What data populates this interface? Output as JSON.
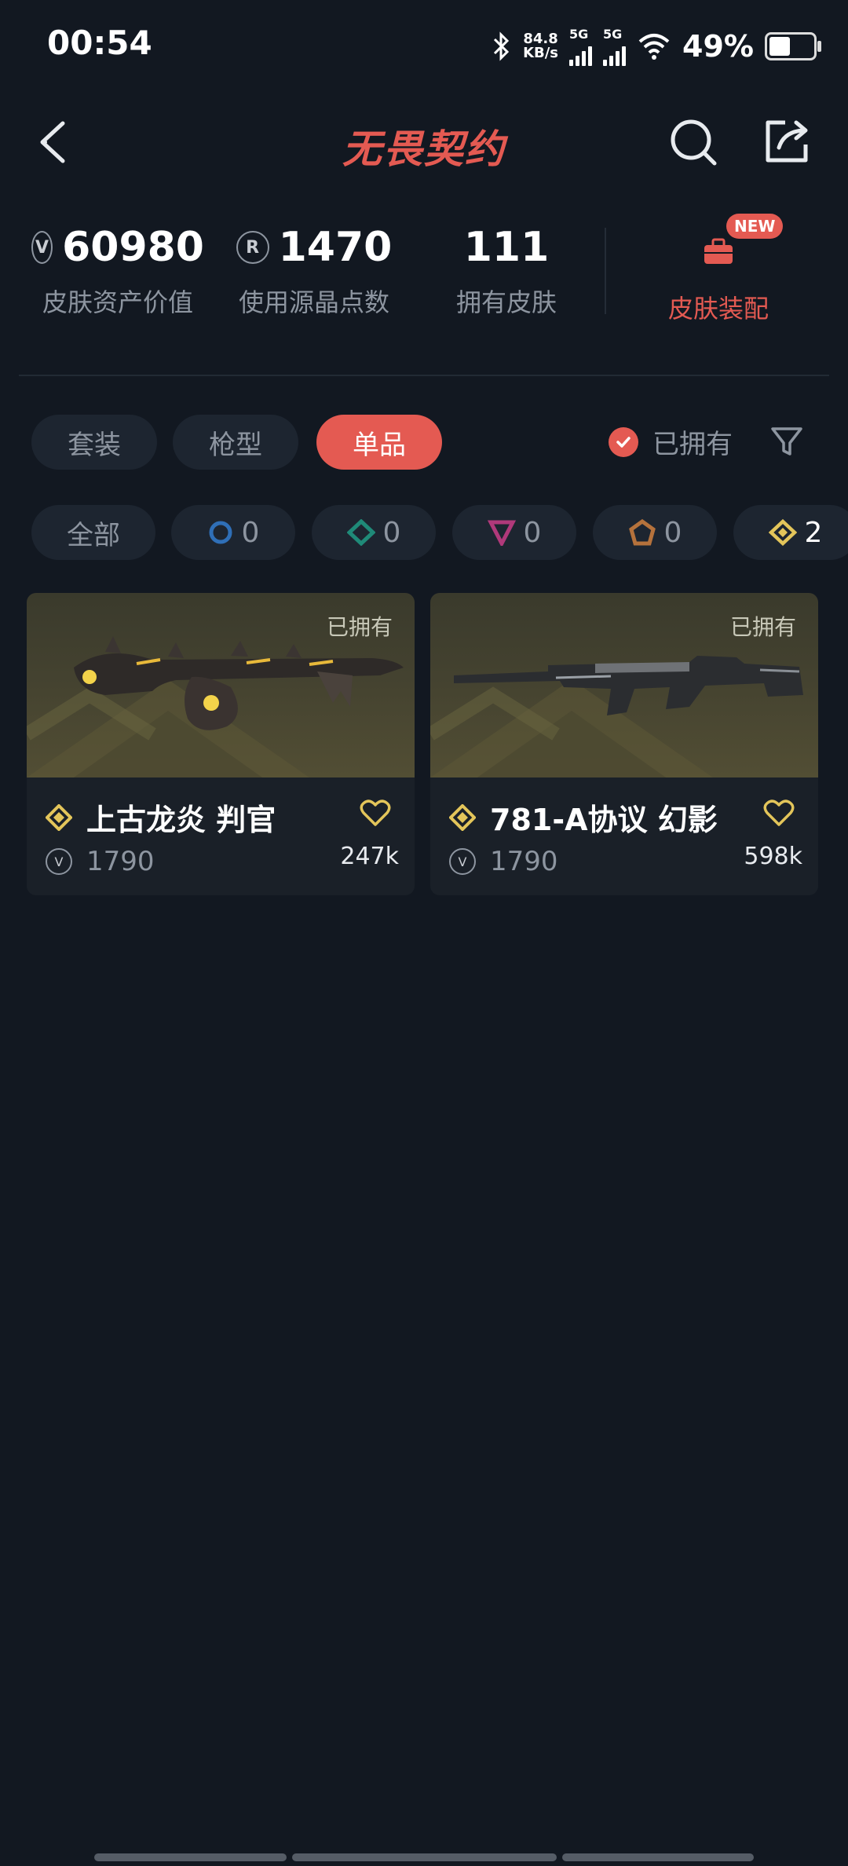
{
  "status_bar": {
    "time": "00:54",
    "net_speed_value": "84.8",
    "net_speed_unit": "KB/s",
    "signal1_label": "5G",
    "signal2_label": "5G",
    "battery": "49%"
  },
  "header": {
    "logo": "无畏契约"
  },
  "stats": {
    "asset_value": "60980",
    "asset_label": "皮肤资产价值",
    "radianite_points": "1470",
    "radianite_label": "使用源晶点数",
    "owned_skins": "111",
    "owned_label": "拥有皮肤",
    "equip_label": "皮肤装配",
    "new_badge": "NEW"
  },
  "tabs": [
    {
      "label": "套装"
    },
    {
      "label": "枪型"
    },
    {
      "label": "单品"
    }
  ],
  "owned_filter": {
    "label": "已拥有",
    "checked": true
  },
  "tiers": [
    {
      "label": "全部"
    },
    {
      "count": "0",
      "icon": "select-tier-icon",
      "color": "#2f6fb7"
    },
    {
      "count": "0",
      "icon": "deluxe-tier-icon",
      "color": "#1f8a78"
    },
    {
      "count": "0",
      "icon": "premium-tier-icon",
      "color": "#b0397a"
    },
    {
      "count": "0",
      "icon": "exclusive-tier-icon",
      "color": "#b5723c"
    },
    {
      "count": "2",
      "icon": "ultra-tier-icon",
      "color": "#e3c55a"
    }
  ],
  "items": [
    {
      "owned_tag": "已拥有",
      "name": "上古龙炎 判官",
      "price": "1790",
      "likes": "247k"
    },
    {
      "owned_tag": "已拥有",
      "name": "781-A协议 幻影",
      "price": "1790",
      "likes": "598k"
    }
  ],
  "colors": {
    "accent": "#e45a52",
    "background": "#121821",
    "tier_gold": "#e3c55a"
  }
}
